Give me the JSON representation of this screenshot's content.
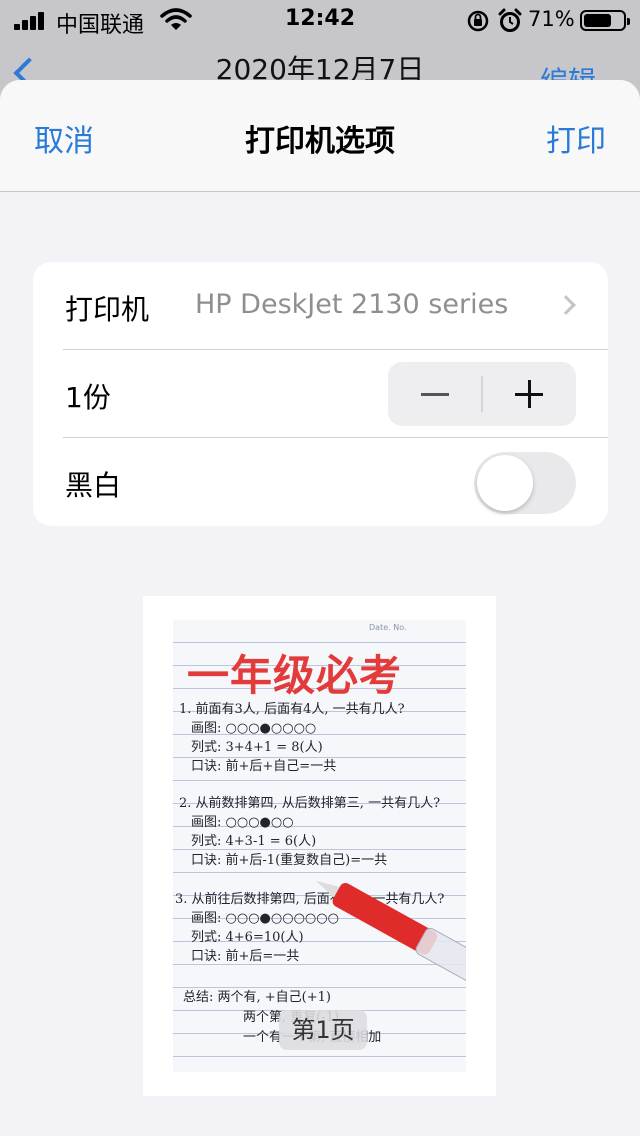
{
  "status_bar": {
    "carrier": "中国联通",
    "time": "12:42",
    "battery": "71%",
    "battery_level": 0.71
  },
  "underlying": {
    "title": "2020年12月7日",
    "edit": "编辑"
  },
  "nav": {
    "cancel": "取消",
    "title": "打印机选项",
    "print": "打印"
  },
  "options": {
    "printer_label": "打印机",
    "printer_value": "HP DeskJet 2130 series",
    "copies_label": "1份",
    "bw_label": "黑白",
    "bw_enabled": false
  },
  "preview": {
    "page_label": "第1页",
    "header_marks": "Date.        No.",
    "title": "一年级必考",
    "lines": [
      "1. 前面有3人, 后面有4人, 一共有几人?",
      "画图: ○○○●○○○○",
      "列式: 3+4+1 = 8(人)",
      "口诀: 前+后+自己=一共",
      "2. 从前数排第四, 从后数排第三, 一共有几人?",
      "画图: ○○○●○○",
      "列式: 4+3-1 = 6(人)",
      "口诀: 前+后-1(重复数自己)=一共",
      "3. 从前往后数排第四, 后面有6人, 一共有几人?",
      "画图: ○○○●○○○○○○",
      "列式: 4+6=10(人)",
      "口诀: 前+后=一共",
      "总结: 两个有, +自己(+1)",
      "两个第, 重复(-1)",
      "一个有一个第, 直接相加"
    ]
  },
  "colors": {
    "accent": "#2a7ad8",
    "title_red": "#e33a3a"
  }
}
